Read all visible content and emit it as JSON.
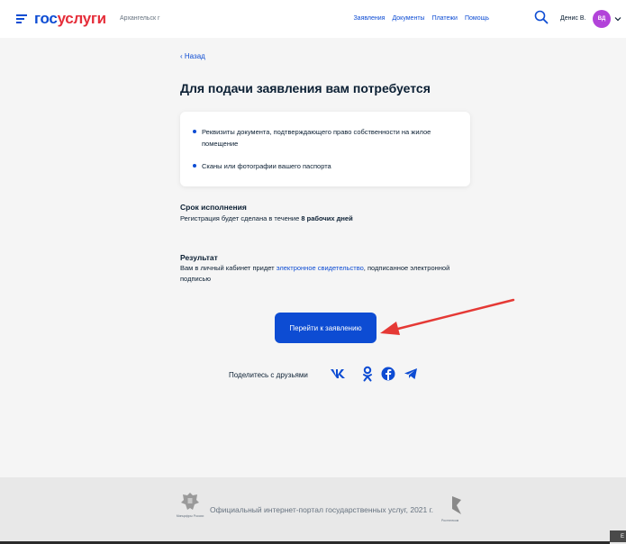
{
  "header": {
    "logo_part1": "гос",
    "logo_part2": "услуги",
    "region": "Архангельск г",
    "nav": [
      "Заявления",
      "Документы",
      "Платежи",
      "Помощь"
    ],
    "user_name": "Денис В.",
    "avatar_initials": "ВД"
  },
  "main": {
    "back_label": "Назад",
    "title": "Для подачи заявления вам потребуется",
    "requirements": [
      "Реквизиты документа, подтверждающего право собственности на жилое помещение",
      "Сканы или фотографии вашего паспорта"
    ],
    "term": {
      "title": "Срок исполнения",
      "text_before": "Регистрация будет сделана в течение ",
      "text_bold": "8 рабочих дней"
    },
    "result": {
      "title": "Результат",
      "text_before": "Вам в личный кабинет придет ",
      "link": "электронное свидетельство",
      "text_after": ", подписанное электронной подписью"
    },
    "cta_label": "Перейти к заявлению",
    "share_label": "Поделитесь с друзьями"
  },
  "icons": {
    "social": [
      "vk-icon",
      "odnoklassniki-icon",
      "facebook-icon",
      "telegram-icon"
    ],
    "annotation": "red-arrow"
  },
  "footer": {
    "emblem_caption": "Минцифры России",
    "text": "Официальный интернет-портал государственных услуг, 2021 г.",
    "partner_caption": "Ростелеком"
  },
  "colors": {
    "brand_blue": "#0d4cd3",
    "brand_red": "#e52e3a",
    "avatar": "#b243d9",
    "arrow": "#e53935"
  }
}
